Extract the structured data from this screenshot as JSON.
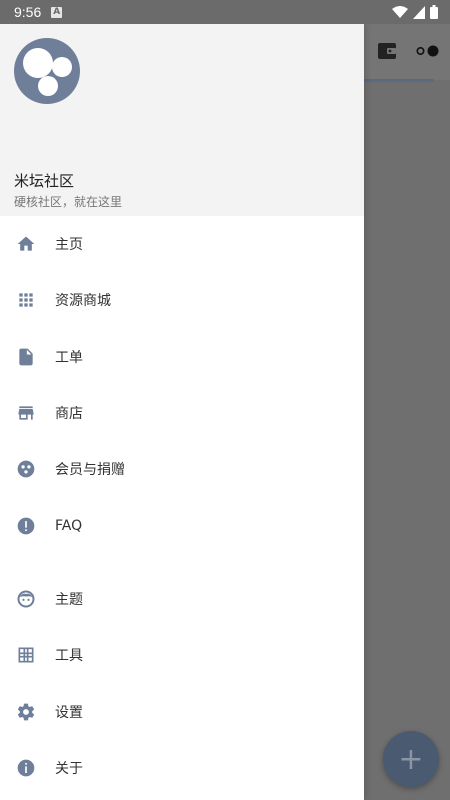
{
  "status_bar": {
    "time": "9:56",
    "notification_icon": "a-badge-icon",
    "icons": [
      "wifi-icon",
      "signal-icon",
      "battery-icon"
    ]
  },
  "drawer": {
    "header": {
      "logo_icon": "bubbles-logo-icon",
      "title": "米坛社区",
      "subtitle": "硬核社区，就在这里"
    },
    "primary_items": [
      {
        "label": "主页",
        "icon": "home-icon"
      },
      {
        "label": "资源商城",
        "icon": "apps-grid-icon"
      },
      {
        "label": "工单",
        "icon": "document-icon"
      },
      {
        "label": "商店",
        "icon": "store-icon"
      },
      {
        "label": "会员与捐赠",
        "icon": "palette-icon"
      },
      {
        "label": "FAQ",
        "icon": "exclamation-icon"
      }
    ],
    "secondary_items": [
      {
        "label": "主题",
        "icon": "face-icon"
      },
      {
        "label": "工具",
        "icon": "grid-table-icon"
      },
      {
        "label": "设置",
        "icon": "gear-icon"
      },
      {
        "label": "关于",
        "icon": "info-icon"
      }
    ]
  },
  "background": {
    "fab_label": "+",
    "toolbar_icons": [
      "wallet-icon",
      "toggle-icon"
    ]
  },
  "colors": {
    "accent": "#6f7f99",
    "icon": "#6f7f99",
    "scrim": "#6f6f6f",
    "fab": "#4a5a70"
  }
}
